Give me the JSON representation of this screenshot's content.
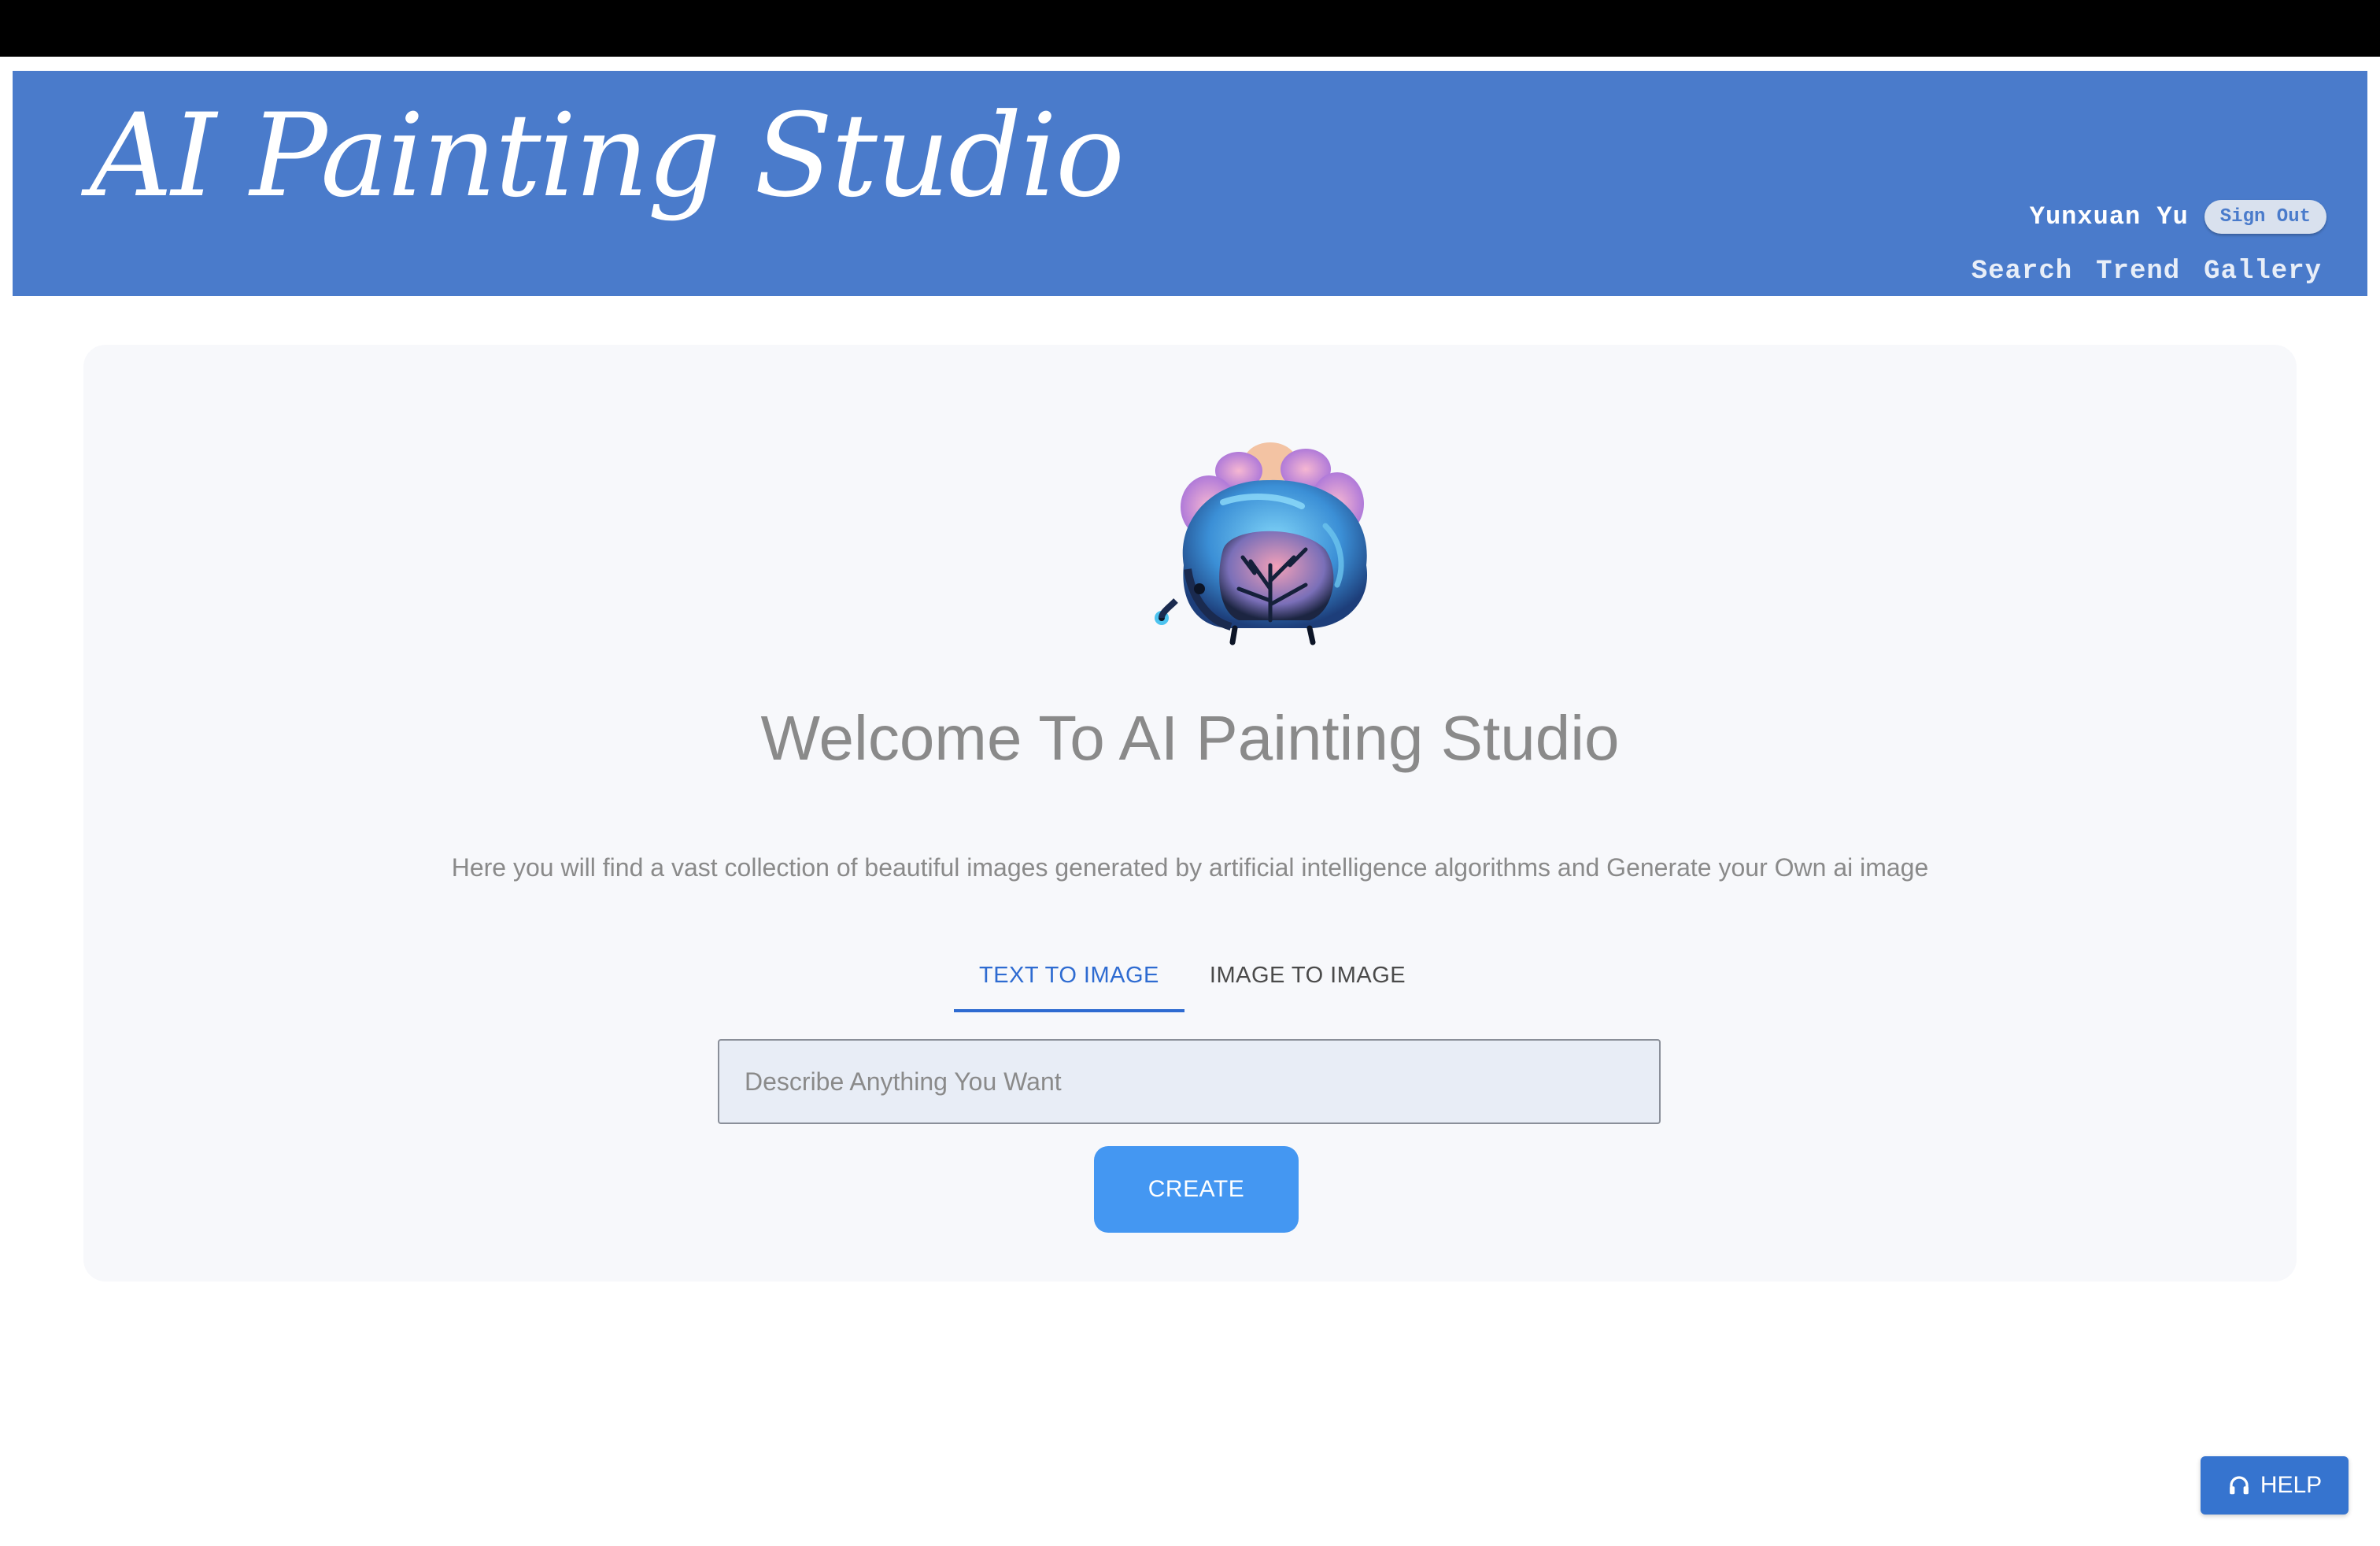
{
  "header": {
    "brand": "AI Painting Studio",
    "background_color": "#4a7bcb",
    "username": "Yunxuan Yu",
    "sign_out_label": "Sign Out",
    "nav": [
      {
        "label": "Search"
      },
      {
        "label": "Trend"
      },
      {
        "label": "Gallery"
      }
    ]
  },
  "main": {
    "logo_icon": "brain-tree-artwork-icon",
    "welcome_title": "Welcome To AI Painting Studio",
    "subtitle": "Here you will find a vast collection of beautiful images generated by artificial intelligence algorithms and Generate your Own ai image",
    "tabs": [
      {
        "label": "TEXT TO IMAGE",
        "active": true
      },
      {
        "label": "IMAGE TO IMAGE",
        "active": false
      }
    ],
    "prompt": {
      "value": "",
      "placeholder": "Describe Anything You Want"
    },
    "create_label": "CREATE",
    "accent_color": "#2e6bd1"
  },
  "help": {
    "label": "HELP",
    "icon": "headset-icon"
  }
}
